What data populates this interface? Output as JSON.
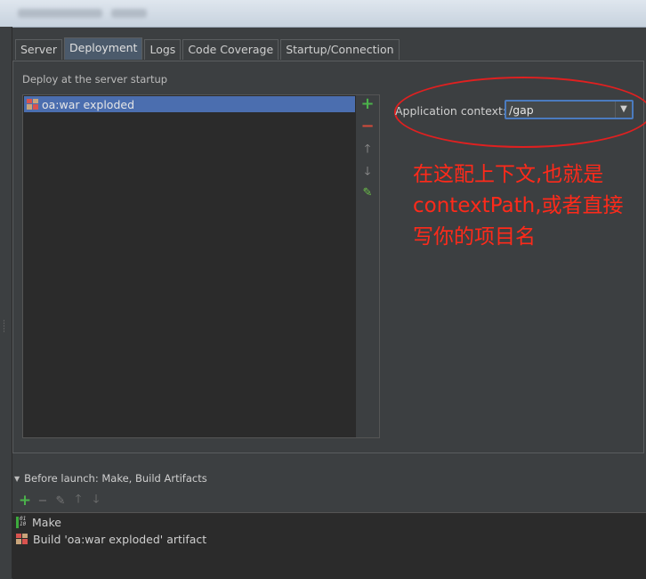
{
  "tabs": [
    {
      "label": "Server"
    },
    {
      "label": "Deployment"
    },
    {
      "label": "Logs"
    },
    {
      "label": "Code Coverage"
    },
    {
      "label": "Startup/Connection"
    }
  ],
  "active_tab": "Deployment",
  "deploy": {
    "section_label": "Deploy at the server startup",
    "items": [
      {
        "label": "oa:war exploded",
        "selected": true
      }
    ]
  },
  "context": {
    "label": "Application context:",
    "value": "/gap"
  },
  "annotation": {
    "line1": "在这配上下文,也就是",
    "line2": "contextPath,或者直接",
    "line3": "写你的项目名",
    "color": "#ff2a1a"
  },
  "before_launch": {
    "label": "Before launch: Make, Build Artifacts",
    "items": [
      {
        "label": "Make",
        "icon": "make-icon"
      },
      {
        "label": "Build 'oa:war exploded' artifact",
        "icon": "artifact-icon"
      }
    ]
  },
  "colors": {
    "background": "#3c3f41",
    "list_background": "#2b2b2b",
    "selection": "#4b6eaf",
    "add_green": "#4bb24b",
    "remove_red": "#d04b3b"
  }
}
